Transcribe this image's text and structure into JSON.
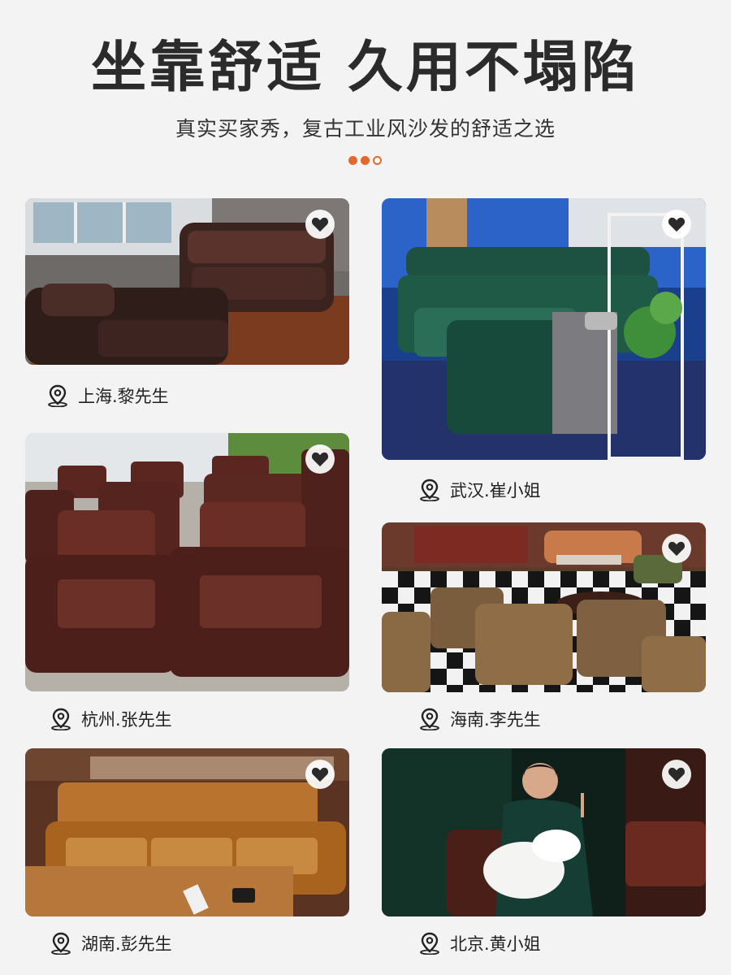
{
  "header": {
    "title": "坐靠舒适 久用不塌陷",
    "subtitle": "真实买家秀，复古工业风沙发的舒适之选"
  },
  "accent_color": "#e06a2c",
  "pagination": {
    "filled": 2,
    "total": 3
  },
  "cards": [
    {
      "location": "上海.黎先生",
      "favorite_icon": "heart-icon",
      "pin_icon": "location-pin-icon"
    },
    {
      "location": "武汉.崔小姐",
      "favorite_icon": "heart-icon",
      "pin_icon": "location-pin-icon"
    },
    {
      "location": "杭州.张先生",
      "favorite_icon": "heart-icon",
      "pin_icon": "location-pin-icon"
    },
    {
      "location": "海南.李先生",
      "favorite_icon": "heart-icon",
      "pin_icon": "location-pin-icon"
    },
    {
      "location": "湖南.彭先生",
      "favorite_icon": "heart-icon",
      "pin_icon": "location-pin-icon"
    },
    {
      "location": "北京.黄小姐",
      "favorite_icon": "heart-icon",
      "pin_icon": "location-pin-icon"
    }
  ]
}
